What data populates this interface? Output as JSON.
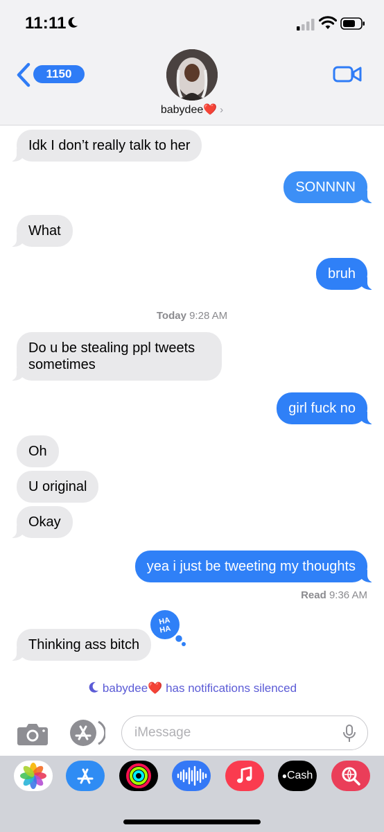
{
  "status_bar": {
    "time": "11:11"
  },
  "header": {
    "back_count": "1150",
    "contact_name": "babydee",
    "contact_heart": "❤️",
    "chevron": "›"
  },
  "messages": [
    {
      "dir": "in",
      "text": "Idk I don’t really talk to her"
    },
    {
      "dir": "out",
      "text": "SONNNN"
    },
    {
      "dir": "in",
      "text": "What"
    },
    {
      "dir": "out",
      "text": "bruh"
    },
    {
      "dir": "in",
      "text_line1": "Do u be stealing ppl tweets",
      "text_line2": "sometimes"
    },
    {
      "dir": "out",
      "text": "girl fuck no"
    },
    {
      "dir": "in",
      "text": "Oh"
    },
    {
      "dir": "in",
      "text": "U original"
    },
    {
      "dir": "in",
      "text": "Okay"
    },
    {
      "dir": "out",
      "text": "yea i just be tweeting my thoughts"
    },
    {
      "dir": "in",
      "text": "Thinking ass bitch",
      "tapback": "HA HA"
    }
  ],
  "timestamp": {
    "day": "Today",
    "time": "9:28 AM"
  },
  "receipt": {
    "label": "Read",
    "time": "9:36 AM"
  },
  "silenced_notice": {
    "name": "babydee",
    "heart": "❤️",
    "text": "has notifications silenced"
  },
  "input": {
    "placeholder": "iMessage"
  },
  "app_drawer": [
    {
      "name": "Photos",
      "icon": "photos-icon"
    },
    {
      "name": "App Store",
      "icon": "app-store-icon"
    },
    {
      "name": "Fitness",
      "icon": "activity-rings-icon"
    },
    {
      "name": "Audio Message",
      "icon": "audio-wave-icon"
    },
    {
      "name": "Music",
      "icon": "music-note-icon"
    },
    {
      "name": "Apple Cash",
      "icon": "apple-cash-icon",
      "label": "Cash"
    },
    {
      "name": "Images Search",
      "icon": "image-search-icon"
    }
  ],
  "colors": {
    "accent": "#2f80f7",
    "incoming": "#e9e9eb",
    "silenced": "#5b5bd6"
  }
}
